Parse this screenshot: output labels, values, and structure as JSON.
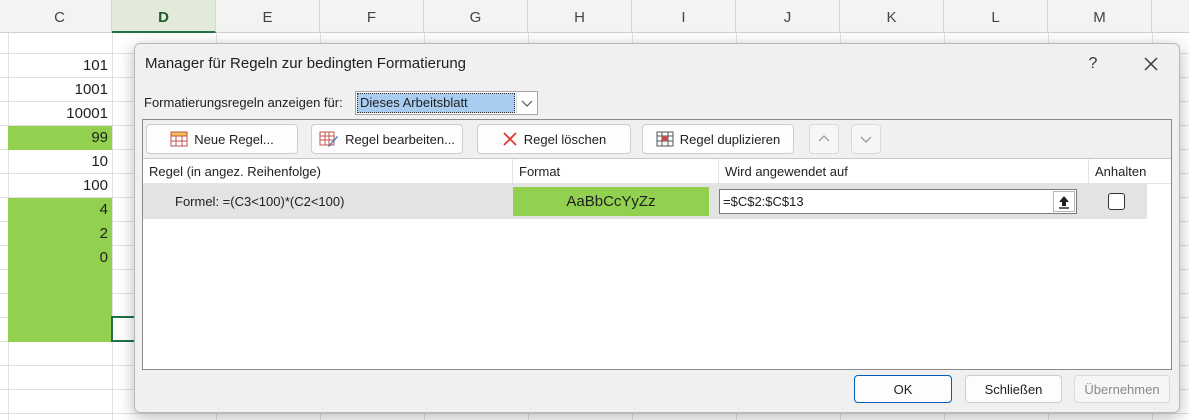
{
  "spreadsheet": {
    "columns": [
      "C",
      "D",
      "E",
      "F",
      "G",
      "H",
      "I",
      "J",
      "K",
      "L",
      "M"
    ],
    "active_column": "D",
    "rows": [
      {
        "value": "101",
        "highlighted": false
      },
      {
        "value": "1001",
        "highlighted": false
      },
      {
        "value": "10001",
        "highlighted": false
      },
      {
        "value": "99",
        "highlighted": true
      },
      {
        "value": "10",
        "highlighted": false
      },
      {
        "value": "100",
        "highlighted": false
      },
      {
        "value": "4",
        "highlighted": true
      },
      {
        "value": "2",
        "highlighted": true
      },
      {
        "value": "0",
        "highlighted": true
      }
    ],
    "highlight_color": "#92d050"
  },
  "dialog": {
    "title": "Manager für Regeln zur bedingten Formatierung",
    "help_label": "?",
    "close_label": "✕",
    "show_rules_label": "Formatierungsregeln anzeigen für:",
    "show_rules_value": "Dieses Arbeitsblatt",
    "toolbar": {
      "new_rule": "Neue Regel...",
      "edit_rule": "Regel bearbeiten...",
      "delete_rule": "Regel löschen",
      "duplicate_rule": "Regel duplizieren"
    },
    "list": {
      "headers": {
        "rule": "Regel (in angez. Reihenfolge)",
        "format": "Format",
        "applies_to": "Wird angewendet auf",
        "stop": "Anhalten"
      },
      "rules": [
        {
          "rule": "Formel: =(C3<100)*(C2<100)",
          "format_preview": "AaBbCcYyZz",
          "format_color": "#92d050",
          "applies_to": "=$C$2:$C$13",
          "stop_if_true": false
        }
      ]
    },
    "buttons": {
      "ok": "OK",
      "close": "Schließen",
      "apply": "Übernehmen"
    }
  }
}
